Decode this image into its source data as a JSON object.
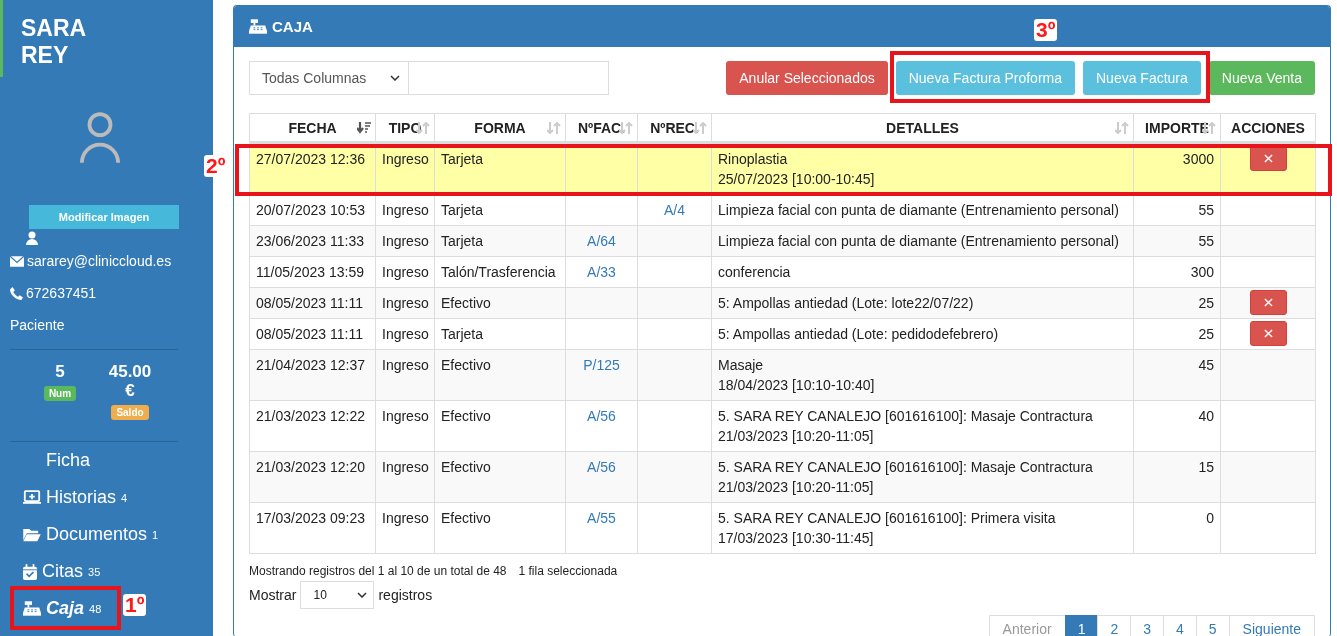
{
  "sidebar": {
    "name": "SARA\nREY",
    "photo_button": "Modificar Imagen",
    "contacts": [
      {
        "kind": "email",
        "text": "sararey@cliniccloud.es"
      },
      {
        "kind": "phone",
        "text": "672637451"
      },
      {
        "kind": "role",
        "text": "Paciente"
      }
    ],
    "stats": [
      {
        "value": "5",
        "badge": "Num",
        "color": "#5cb85c"
      },
      {
        "value": "45.00\n€",
        "badge": "Saldo",
        "color": "#f0ad4e"
      }
    ],
    "nav": [
      {
        "kind": "file",
        "label": "Ficha",
        "selected": false
      },
      {
        "kind": "history",
        "label": "Historias",
        "count": "4",
        "selected": false
      },
      {
        "kind": "folder",
        "label": "Documentos",
        "count": "1",
        "selected": false
      },
      {
        "kind": "calendar",
        "label": "Citas",
        "count": "35",
        "selected": false
      },
      {
        "kind": "register",
        "label": "Caja",
        "count": "48",
        "selected": true
      }
    ]
  },
  "panel": {
    "title": "CAJA",
    "filter": {
      "select": "Todas Columnas"
    },
    "buttons": [
      {
        "kind": "danger",
        "label": "Anular Seleccionados"
      },
      {
        "kind": "info",
        "label": "Nueva Factura Proforma"
      },
      {
        "kind": "info",
        "label": "Nueva Factura"
      },
      {
        "kind": "success",
        "label": "Nueva Venta"
      }
    ],
    "table": {
      "columns": [
        {
          "label": "FECHA",
          "sortable": true,
          "sorted": true
        },
        {
          "label": "TIPO",
          "sortable": true,
          "sorted": false
        },
        {
          "label": "FORMA",
          "sortable": true,
          "sorted": false
        },
        {
          "label": "NºFAC.",
          "sortable": true,
          "sorted": false
        },
        {
          "label": "NºREC.",
          "sortable": true,
          "sorted": false
        },
        {
          "label": "DETALLES",
          "sortable": true,
          "sorted": false
        },
        {
          "label": "IMPORTE",
          "sortable": true,
          "sorted": false
        },
        {
          "label": "ACCIONES",
          "sortable": false
        }
      ],
      "rows": [
        {
          "selected": true,
          "fecha": "27/07/2023 12:36",
          "tipo": "Ingreso",
          "forma": "Tarjeta",
          "fac": "",
          "rec": "",
          "detalles": "Rinoplastia\n25/07/2023 [10:00-10:45]",
          "importe": "3000",
          "deletable": true
        },
        {
          "selected": false,
          "fecha": "20/07/2023 10:53",
          "tipo": "Ingreso",
          "forma": "Tarjeta",
          "fac": "",
          "rec": "A/4",
          "detalles": "Limpieza facial con punta de diamante (Entrenamiento personal)",
          "importe": "55",
          "deletable": false
        },
        {
          "selected": false,
          "fecha": "23/06/2023 11:33",
          "tipo": "Ingreso",
          "forma": "Tarjeta",
          "fac": "A/64",
          "rec": "",
          "detalles": "Limpieza facial con punta de diamante (Entrenamiento personal)",
          "importe": "55",
          "deletable": false
        },
        {
          "selected": false,
          "fecha": "11/05/2023 13:59",
          "tipo": "Ingreso",
          "forma": "Talón/Trasferencia",
          "fac": "A/33",
          "rec": "",
          "detalles": "conferencia",
          "importe": "300",
          "deletable": false
        },
        {
          "selected": false,
          "fecha": "08/05/2023 11:11",
          "tipo": "Ingreso",
          "forma": "Efectivo",
          "fac": "",
          "rec": "",
          "detalles": "5: Ampollas antiedad (Lote: lote22/07/22)",
          "importe": "25",
          "deletable": true
        },
        {
          "selected": false,
          "fecha": "08/05/2023 11:11",
          "tipo": "Ingreso",
          "forma": "Tarjeta",
          "fac": "",
          "rec": "",
          "detalles": "5: Ampollas antiedad (Lote: pedidodefebrero)",
          "importe": "25",
          "deletable": true
        },
        {
          "selected": false,
          "fecha": "21/04/2023 12:37",
          "tipo": "Ingreso",
          "forma": "Efectivo",
          "fac": "P/125",
          "rec": "",
          "detalles": "Masaje\n18/04/2023 [10:10-10:40]",
          "importe": "45",
          "deletable": false
        },
        {
          "selected": false,
          "fecha": "21/03/2023 12:22",
          "tipo": "Ingreso",
          "forma": "Efectivo",
          "fac": "A/56",
          "rec": "",
          "detalles": "5. SARA REY CANALEJO [601616100]: Masaje Contractura\n21/03/2023 [10:20-11:05]",
          "importe": "40",
          "deletable": false
        },
        {
          "selected": false,
          "fecha": "21/03/2023 12:20",
          "tipo": "Ingreso",
          "forma": "Efectivo",
          "fac": "A/56",
          "rec": "",
          "detalles": "5. SARA REY CANALEJO [601616100]: Masaje Contractura\n21/03/2023 [10:20-11:05]",
          "importe": "15",
          "deletable": false
        },
        {
          "selected": false,
          "fecha": "17/03/2023 09:23",
          "tipo": "Ingreso",
          "forma": "Efectivo",
          "fac": "A/55",
          "rec": "",
          "detalles": "5. SARA REY CANALEJO [601616100]: Primera visita\n17/03/2023 [10:30-11:45]",
          "importe": "0",
          "deletable": false
        }
      ]
    },
    "info": "Mostrando registros del 1 al 10 de un total de 48",
    "selection_info": "1 fila seleccionada",
    "length": {
      "before": "Mostrar",
      "value": "10",
      "after": "registros"
    },
    "pagination": [
      {
        "kind": "prev",
        "label": "Anterior",
        "disabled": true,
        "selected": false
      },
      {
        "kind": "page",
        "label": "1",
        "disabled": false,
        "selected": true
      },
      {
        "kind": "page",
        "label": "2",
        "disabled": false,
        "selected": false
      },
      {
        "kind": "page",
        "label": "3",
        "disabled": false,
        "selected": false
      },
      {
        "kind": "page",
        "label": "4",
        "disabled": false,
        "selected": false
      },
      {
        "kind": "page",
        "label": "5",
        "disabled": false,
        "selected": false
      },
      {
        "kind": "next",
        "label": "Siguiente",
        "disabled": false,
        "selected": false
      }
    ]
  },
  "annotations": [
    {
      "label": "1º"
    },
    {
      "label": "2º"
    },
    {
      "label": "3º"
    }
  ]
}
